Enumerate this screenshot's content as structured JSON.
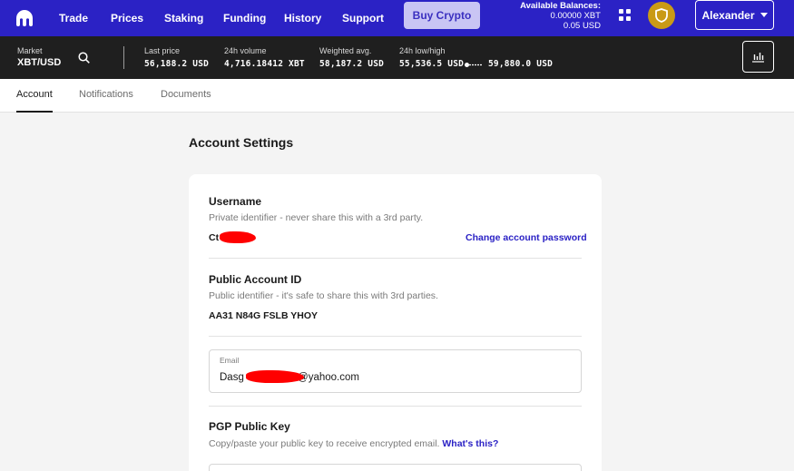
{
  "nav": {
    "items": [
      "Trade",
      "Prices",
      "Staking",
      "Funding",
      "History",
      "Support"
    ],
    "buy_label": "Buy Crypto",
    "balances_title": "Available Balances:",
    "balance_xbt": "0.00000 XBT",
    "balance_usd": "0.05 USD",
    "user_name": "Alexander",
    "brand_color": "#2b22c5"
  },
  "ticker": {
    "market_label": "Market",
    "market_value": "XBT/USD",
    "last_price_label": "Last price",
    "last_price_value": "56,188.2 USD",
    "volume_label": "24h volume",
    "volume_value": "4,716.18412 XBT",
    "weighted_label": "Weighted avg.",
    "weighted_value": "58,187.2 USD",
    "lowhigh_label": "24h low/high",
    "low_value": "55,536.5 USD",
    "high_value": "59,880.0 USD"
  },
  "tabs": [
    "Account",
    "Notifications",
    "Documents"
  ],
  "page": {
    "title": "Account Settings",
    "username": {
      "title": "Username",
      "desc": "Private identifier - never share this with a 3rd party.",
      "value_prefix": "Ct",
      "change_link": "Change account password"
    },
    "public_id": {
      "title": "Public Account ID",
      "desc": "Public identifier - it's safe to share this with 3rd parties.",
      "value": "AA31 N84G FSLB YHOY"
    },
    "email": {
      "label": "Email",
      "value_prefix": "Dasg",
      "value_suffix": "t@yahoo.com"
    },
    "pgp": {
      "title": "PGP Public Key",
      "desc": "Copy/paste your public key to receive encrypted email.",
      "link": "What's this?"
    }
  },
  "icons": {
    "logo": "kraken-logo-icon",
    "grid": "apps-grid-icon",
    "shield": "shield-icon",
    "search": "search-icon",
    "chart": "chart-icon"
  }
}
